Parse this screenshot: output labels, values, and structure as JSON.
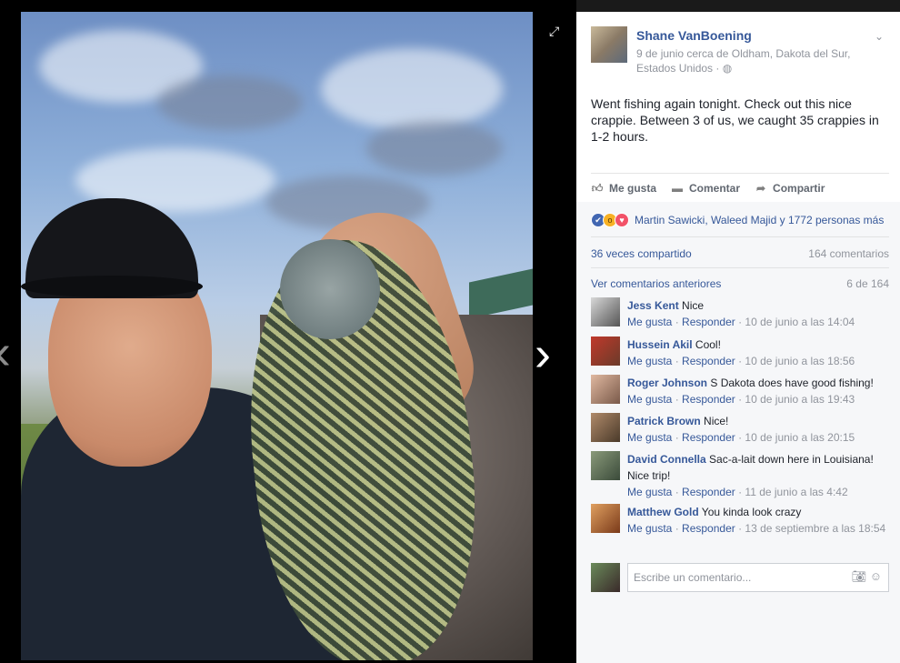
{
  "viewer": {
    "expand_icon": "expand-icon",
    "prev_arrow": "‹",
    "next_arrow": "›",
    "photo_alt": ""
  },
  "post": {
    "author": "Shane VanBoening",
    "meta_line": "9 de junio cerca de Oldham, Dakota del Sur, Estados Unidos ·",
    "privacy_icon": "globe-icon",
    "text": "Went fishing again tonight. Check out this nice crappie. Between 3 of us, we caught 35 crappies in 1-2 hours.",
    "actions": {
      "like": "Me gusta",
      "comment": "Comentar",
      "share": "Compartir"
    },
    "reactions_text": "Martin Sawicki, Waleed Majid y 1772 personas más",
    "shares": "36 veces compartido",
    "comment_count": "164 comentarios",
    "previous_comments": "Ver comentarios anteriores",
    "previous_count": "6 de 164"
  },
  "comments": [
    {
      "author": "Jess Kent",
      "text": "Nice",
      "like": "Me gusta",
      "reply": "Responder",
      "time": "10 de junio a las 14:04"
    },
    {
      "author": "Hussein Akil",
      "text": "Cool!",
      "like": "Me gusta",
      "reply": "Responder",
      "time": "10 de junio a las 18:56"
    },
    {
      "author": "Roger Johnson",
      "text": "S Dakota does have good fishing!",
      "like": "Me gusta",
      "reply": "Responder",
      "time": "10 de junio a las 19:43"
    },
    {
      "author": "Patrick Brown",
      "text": "Nice!",
      "like": "Me gusta",
      "reply": "Responder",
      "time": "10 de junio a las 20:15"
    },
    {
      "author": "David Connella",
      "text": "Sac-a-lait down here in Louisiana! Nice trip!",
      "like": "Me gusta",
      "reply": "Responder",
      "time": "11 de junio a las 4:42"
    },
    {
      "author": "Matthew Gold",
      "text": "You kinda look crazy",
      "like": "Me gusta",
      "reply": "Responder",
      "time": "13 de septiembre a las 18:54"
    }
  ],
  "composer": {
    "placeholder": "Escribe un comentario...",
    "camera_icon": "camera-icon",
    "emoji_icon": "emoji-icon"
  },
  "colors": {
    "link": "#365899",
    "meta": "#90949c",
    "like_blue": "#4267b2",
    "love_red": "#f25268",
    "wow_yellow": "#f7b125"
  }
}
